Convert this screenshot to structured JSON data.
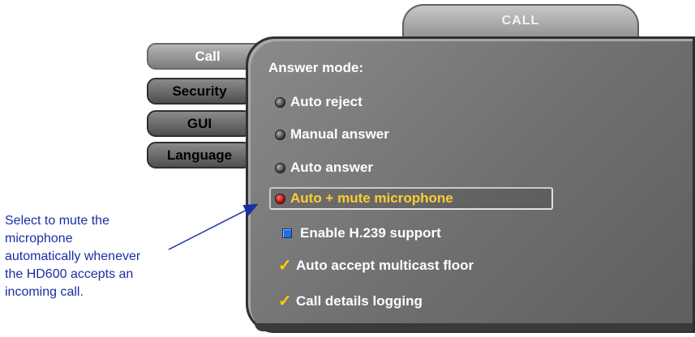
{
  "window": {
    "title": "CALL"
  },
  "tabs": [
    {
      "label": "Call",
      "active": true
    },
    {
      "label": "Security",
      "active": false
    },
    {
      "label": "GUI",
      "active": false
    },
    {
      "label": "Language",
      "active": false
    }
  ],
  "answer_mode": {
    "title": "Answer mode:",
    "options": [
      {
        "label": "Auto reject",
        "selected": false
      },
      {
        "label": "Manual answer",
        "selected": false
      },
      {
        "label": "Auto answer",
        "selected": false
      },
      {
        "label": "Auto + mute microphone",
        "selected": true
      }
    ]
  },
  "settings": {
    "h239": {
      "label": "Enable H.239 support",
      "checked": true
    },
    "multicast": {
      "label": "Auto accept multicast floor",
      "checked": true
    },
    "logging": {
      "label": "Call details logging",
      "checked": true
    }
  },
  "annotation": {
    "lines": [
      "Select to mute the",
      "microphone",
      "automatically whenever",
      "the HD600 accepts an",
      "incoming call."
    ]
  },
  "colors": {
    "panel": "#6f6f6f",
    "highlight_text": "#ffcc33",
    "annotation_text": "#1a2fa3",
    "checkbox": "#1f6fe0",
    "check_mark": "#ffd000",
    "radio_selected": "#b00000"
  }
}
